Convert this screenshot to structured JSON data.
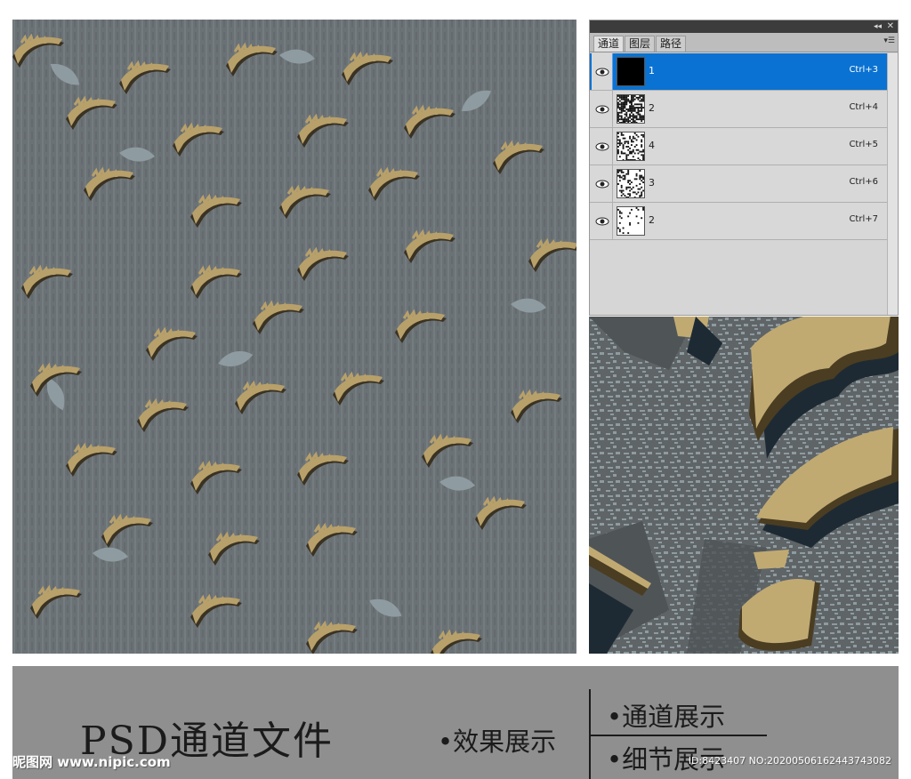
{
  "channels_panel": {
    "tabs": [
      {
        "label": "通道",
        "active": true
      },
      {
        "label": "图层",
        "active": false
      },
      {
        "label": "路径",
        "active": false
      }
    ],
    "collapse_icon": "double-chevron-left-icon",
    "close_icon": "close-icon",
    "menu_icon": "panel-menu-icon",
    "channels": [
      {
        "name": "1",
        "shortcut": "Ctrl+3",
        "selected": true,
        "thumb": "solid-black",
        "noise_density": 1.0
      },
      {
        "name": "2",
        "shortcut": "Ctrl+4",
        "selected": false,
        "thumb": "dense-noise",
        "noise_density": 0.6
      },
      {
        "name": "4",
        "shortcut": "Ctrl+5",
        "selected": false,
        "thumb": "medium-noise",
        "noise_density": 0.3
      },
      {
        "name": "3",
        "shortcut": "Ctrl+6",
        "selected": false,
        "thumb": "medium-noise",
        "noise_density": 0.25
      },
      {
        "name": "2",
        "shortcut": "Ctrl+7",
        "selected": false,
        "thumb": "sparse-noise",
        "noise_density": 0.08
      }
    ]
  },
  "caption": {
    "title": "PSD通道文件",
    "effect_label": "•效果展示",
    "channel_label": "•通道展示",
    "detail_label": "•细节展示"
  },
  "watermark": {
    "site": "昵图网 www.nipic.com",
    "id_text": "ID:8423407 NO:20200506162443743082"
  },
  "colors": {
    "selected_row": "#0a72d2",
    "pattern_base": "#6b7276",
    "pattern_gold": "#b8a06a",
    "pattern_light": "#8e9ba0",
    "pattern_dark": "#1e2a33",
    "caption_band": "#8f8f8f"
  }
}
